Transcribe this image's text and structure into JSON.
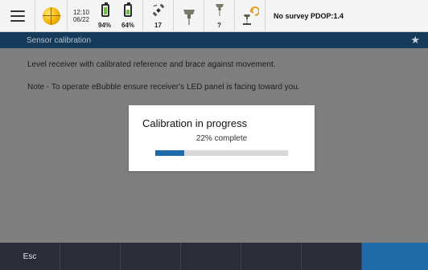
{
  "status_bar": {
    "time": "12:10",
    "date": "06/22",
    "battery_1_label": "94%",
    "battery_1_level": 0.94,
    "battery_2_label": "64%",
    "battery_2_level": 0.64,
    "satellites_label": "17",
    "receiver_2_label": "?",
    "survey_status": "No survey PDOP:1.4",
    "icons": [
      "menu-icon",
      "globe-icon",
      "battery-icon",
      "battery-icon",
      "satellite-icon",
      "gnss-receiver-icon",
      "rover-icon",
      "receiver-connect-icon"
    ]
  },
  "title_bar": {
    "title": "Sensor calibration",
    "favorite_icon": "star-icon"
  },
  "instructions": {
    "line1": "Level receiver with calibrated reference and brace against movement.",
    "line2": "Note - To operate eBubble ensure receiver's LED panel is facing toward you."
  },
  "dialog": {
    "title": "Calibration in progress",
    "progress_text": "22% complete",
    "progress": 0.22
  },
  "soft_keys": [
    "Esc",
    "",
    "",
    "",
    "",
    "",
    ""
  ],
  "colors": {
    "accent": "#1f6aa8",
    "title_bar": "#163a5a",
    "bottom_bar": "#2a2d37",
    "battery_fill": "#6fbf3f"
  }
}
